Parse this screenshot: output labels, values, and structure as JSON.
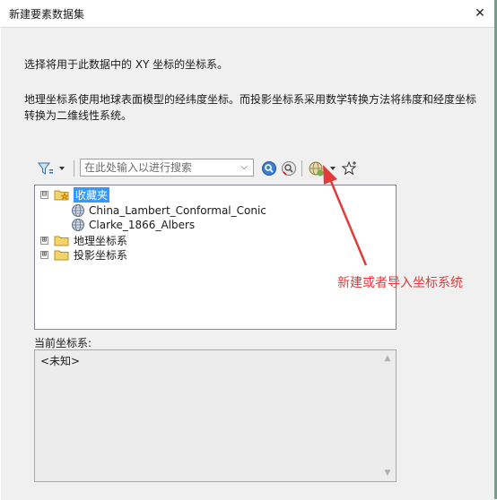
{
  "window": {
    "title": "新建要素数据集"
  },
  "intro": "选择将用于此数据中的 XY 坐标的坐标系。",
  "description_line1": "地理坐标系使用地球表面模型的经纬度坐标。而投影坐标系采用数学转换方法将纬度和经度坐标",
  "description_line2": "转换为二维线性系统。",
  "search": {
    "placeholder": "在此处输入以进行搜索",
    "value": ""
  },
  "tree": {
    "favorites": {
      "label": "收藏夹",
      "expander": "⊟",
      "children": [
        {
          "label": "China_Lambert_Conformal_Conic"
        },
        {
          "label": "Clarke_1866_Albers"
        }
      ]
    },
    "geographic": {
      "label": "地理坐标系",
      "expander": "⊞"
    },
    "projected": {
      "label": "投影坐标系",
      "expander": "⊞"
    }
  },
  "current": {
    "label": "当前坐标系:",
    "value": "<未知>"
  },
  "annotation": "新建或者导入坐标系统",
  "colors": {
    "accent": "#3399ff",
    "annotation": "#e03a3a"
  }
}
